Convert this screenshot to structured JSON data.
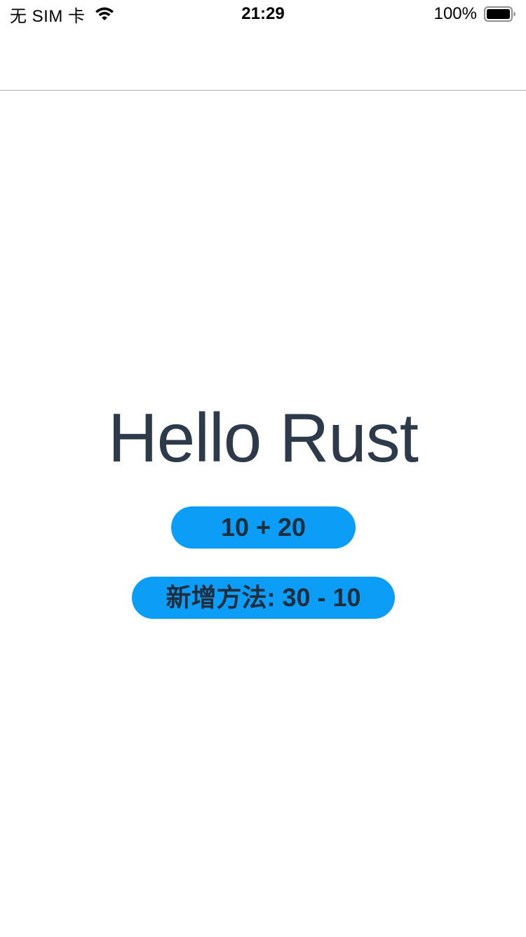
{
  "status_bar": {
    "carrier": "无 SIM 卡",
    "time": "21:29",
    "battery_percent": "100%",
    "wifi_icon": "wifi-icon",
    "battery_icon": "battery-full-icon",
    "battery_level": 1.0
  },
  "main": {
    "title": "Hello Rust",
    "add_button_label": "10 + 20",
    "subtract_button_label": "新增方法: 30 - 10"
  },
  "colors": {
    "button_bg": "#0c9ef6",
    "button_text": "#1f2d3d",
    "title_text": "#2d3a4a",
    "divider": "#b2b2b2"
  }
}
